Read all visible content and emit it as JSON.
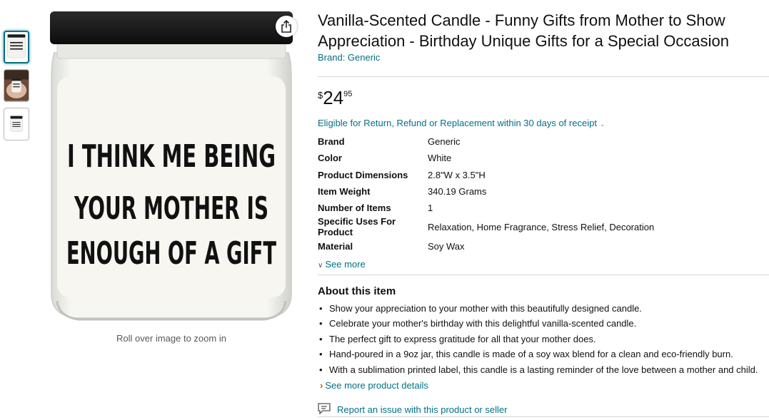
{
  "thumbnails": [
    {
      "name": "thumb-jar-front",
      "alt": "I THINK ME BEING YOUR MOTHER IS ENOUGH OF A GIFT"
    },
    {
      "name": "thumb-lifestyle"
    },
    {
      "name": "thumb-jar-small"
    }
  ],
  "image": {
    "candle_text": [
      "I THINK ME BEING",
      "YOUR MOTHER IS",
      "ENOUGH OF A GIFT"
    ],
    "zoom_hint": "Roll over image to zoom in"
  },
  "product": {
    "title": "Vanilla-Scented Candle - Funny Gifts from Mother to Show Appreciation - Birthday Unique Gifts for a Special Occasion",
    "brand_link": "Brand: Generic",
    "price": {
      "symbol": "$",
      "whole": "24",
      "fraction": "95"
    },
    "returns_text": "Eligible for Return, Refund or Replacement within 30 days of receipt"
  },
  "specs": [
    {
      "key": "Brand",
      "value": "Generic"
    },
    {
      "key": "Color",
      "value": "White"
    },
    {
      "key": "Product Dimensions",
      "value": "2.8\"W x 3.5\"H"
    },
    {
      "key": "Item Weight",
      "value": "340.19 Grams"
    },
    {
      "key": "Number of Items",
      "value": "1"
    },
    {
      "key": "Specific Uses For Product",
      "value": "Relaxation, Home Fragrance, Stress Relief, Decoration"
    },
    {
      "key": "Material",
      "value": "Soy Wax"
    }
  ],
  "see_more_label": "See more",
  "about": {
    "heading": "About this item",
    "bullets": [
      "Show your appreciation to your mother with this beautifully designed candle.",
      "Celebrate your mother's birthday with this delightful vanilla-scented candle.",
      "The perfect gift to express gratitude for all that your mother does.",
      "Hand-poured in a 9oz jar, this candle is made of a soy wax blend for a clean and eco-friendly burn.",
      "With a sublimation printed label, this candle is a lasting reminder of the love between a mother and child."
    ],
    "more_details_label": "See more product details"
  },
  "report_label": "Report an issue with this product or seller",
  "colors": {
    "link": "#007185",
    "text": "#0f1111",
    "muted": "#565959",
    "accent": "#c45500"
  },
  "icons": {
    "share": "share-icon",
    "chevron": "chevron-down-icon",
    "report": "report-flag-icon"
  }
}
